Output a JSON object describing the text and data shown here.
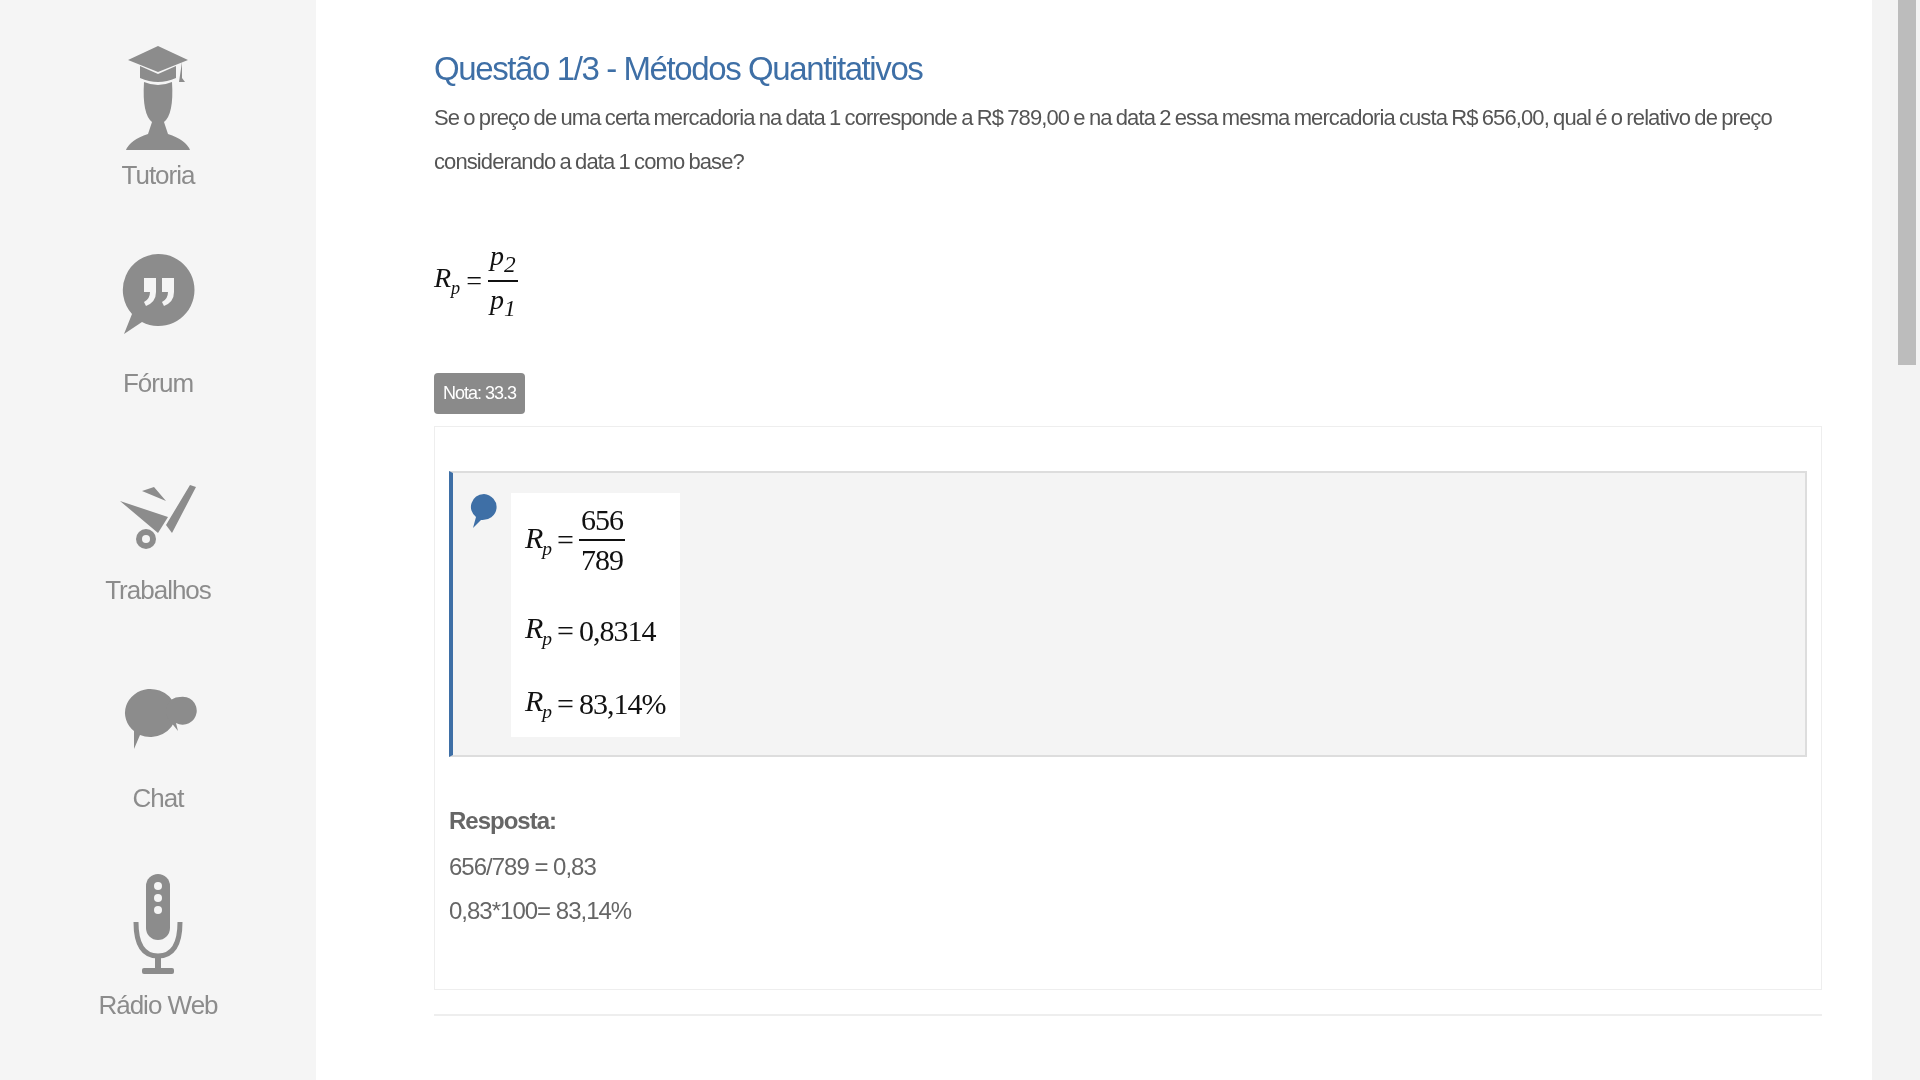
{
  "sidebar": {
    "items": [
      {
        "label": "Tutoria"
      },
      {
        "label": "Fórum"
      },
      {
        "label": "Trabalhos"
      },
      {
        "label": "Chat"
      },
      {
        "label": "Rádio Web"
      }
    ]
  },
  "question": {
    "title": "Questão 1/3 - Métodos Quantitativos",
    "text": "Se o preço de uma certa mercadoria na data 1 corresponde a R$ 789,00 e na data 2 essa mesma mercadoria custa R$ 656,00, qual é o relativo de preço considerando a data 1 como base?",
    "formula": {
      "lhs": "R$_{p}$",
      "relation": "=",
      "numerator": "p$_{2}$",
      "denominator": "p$_{1}$"
    }
  },
  "grade_badge": "Nota: 33.3",
  "feedback": {
    "lines": [
      {
        "kind": "fraction",
        "lhs": "R$_{p}$",
        "relation": "=",
        "numerator": "656",
        "denominator": "789"
      },
      {
        "kind": "equation",
        "lhs": "R$_{p}$",
        "relation": "=",
        "rhs": "0,8314"
      },
      {
        "kind": "equation",
        "lhs": "R$_{p}$",
        "relation": "=",
        "rhs": "83,14%"
      }
    ]
  },
  "answer": {
    "heading": "Resposta:",
    "lines": [
      "656/789 = 0,83",
      "0,83*100= 83,14%"
    ]
  }
}
